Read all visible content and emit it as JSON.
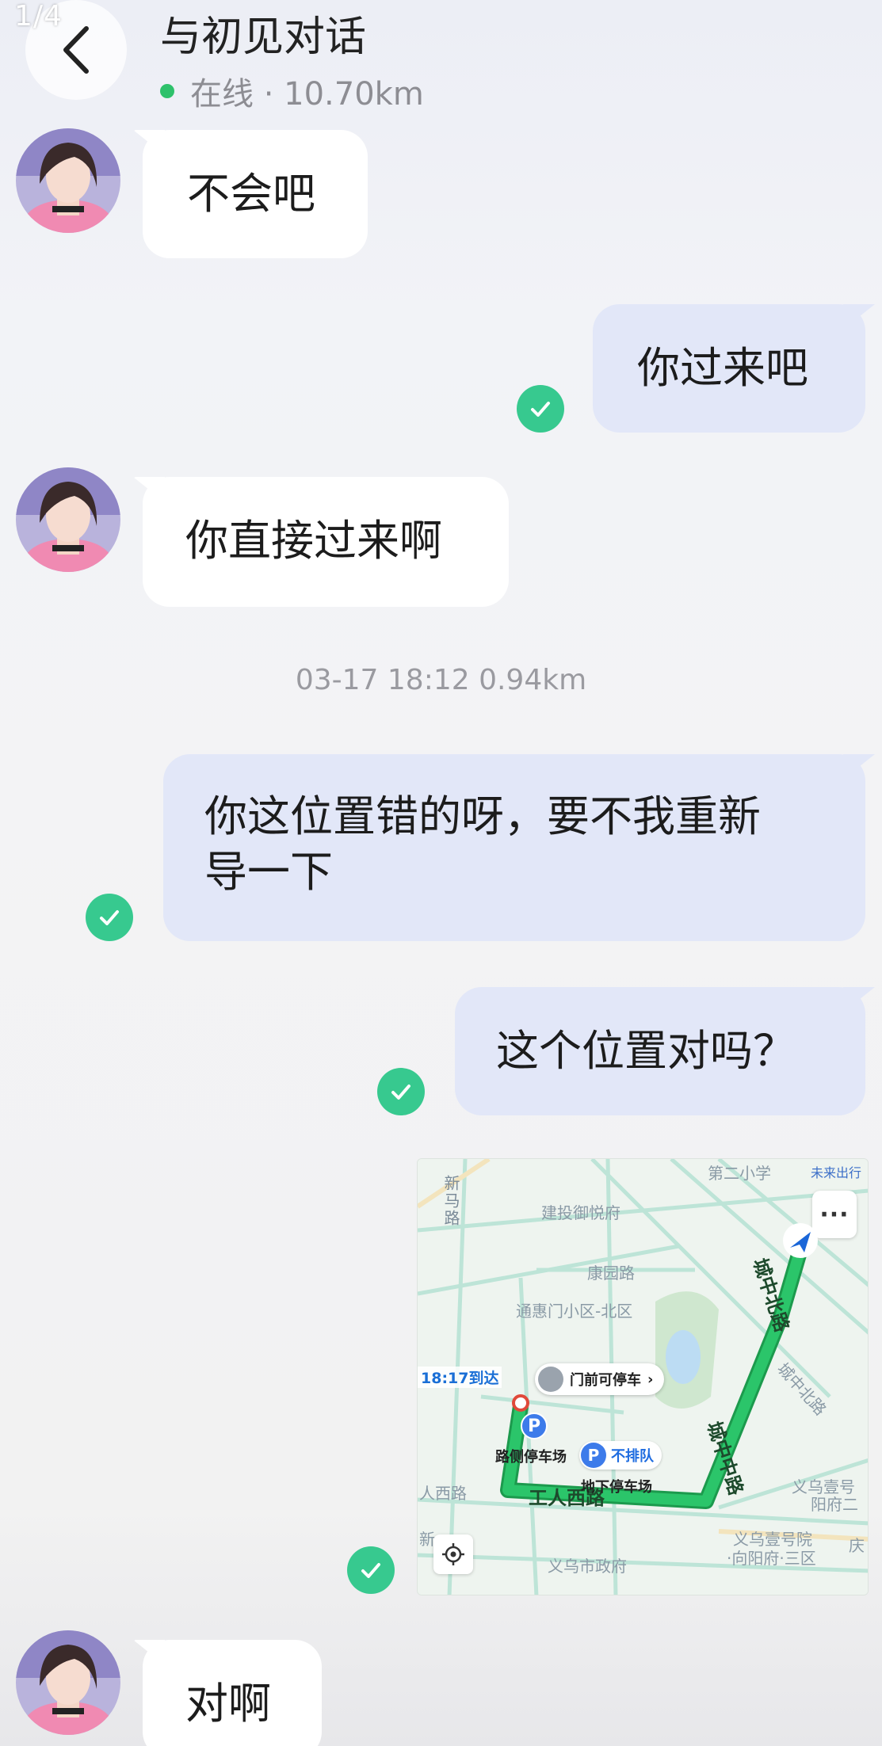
{
  "header": {
    "page_counter": "1/4",
    "title": "与初见对话",
    "status": "在线 · 10.70km"
  },
  "messages": {
    "m1": "不会吧",
    "m2": "你过来吧",
    "m3": "你直接过来啊",
    "timestamp": "03-17 18:12  0.94km",
    "m4_line1": "你这位置错的呀，要不我重新",
    "m4_line2": "导一下",
    "m5": "这个位置对吗？",
    "m6": "对啊"
  },
  "map": {
    "labels": {
      "school": "第二小学",
      "traffic": "未来出行",
      "new_road": "新马路",
      "jiantou": "建投御悦府",
      "kangyuan": "康园路",
      "tonghui": "通惠门小区-北区",
      "chengzhongbei": "城中北路",
      "chengzhongzhong": "城中中路",
      "north_rd2": "城中北路",
      "yiwu1": "义乌壹号",
      "yangfu2": "阳府二",
      "gongren": "工人西路",
      "xilu": "人西路",
      "yiwu_yuan": "义乌壹号院",
      "xiangyang": "·向阳府·三区",
      "gov": "义乌市政府",
      "qing": "庆",
      "xin": "新"
    },
    "eta": "18:17到达",
    "parking_hint": "门前可停车",
    "roadside_parking": "路侧停车场",
    "no_queue": "不排队",
    "underground_parking": "地下停车场",
    "more": "···",
    "p": "P"
  },
  "colors": {
    "online": "#2ec16b",
    "check": "#37c98f",
    "bubble_out": "#e2e7f8",
    "bubble_in": "#ffffff",
    "route": "#1fb45a"
  },
  "icons": {
    "back": "chevron-left-icon",
    "check": "check-circle-icon",
    "locate": "locate-icon",
    "nav": "navigation-arrow-icon"
  }
}
